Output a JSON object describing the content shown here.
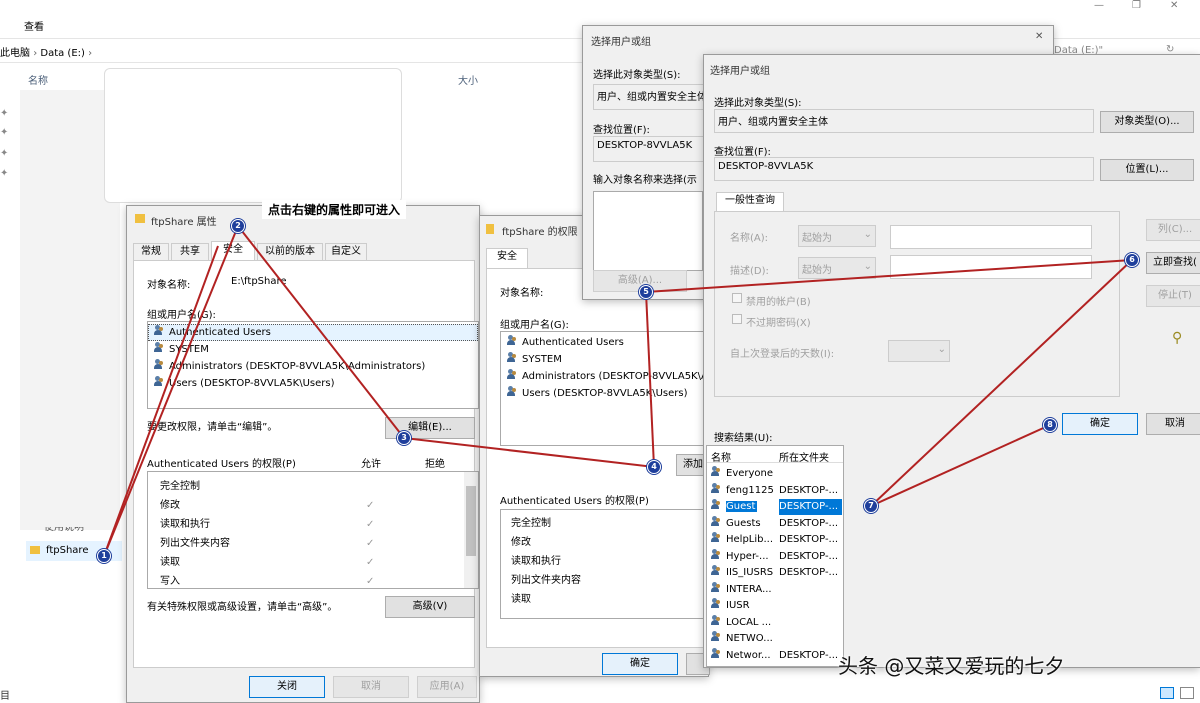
{
  "explorer": {
    "menu_view": "查看",
    "breadcrumb": [
      "此电脑",
      "Data (E:)"
    ],
    "col_name": "名称",
    "col_size": "大小",
    "folder": "ftpShare",
    "partial_item": "使用说明",
    "status_left": "目"
  },
  "annotation": "点击右键的属性即可进入",
  "props": {
    "title": "ftpShare 属性",
    "tabs": [
      "常规",
      "共享",
      "安全",
      "以前的版本",
      "自定义"
    ],
    "object_label": "对象名称:",
    "object_value": "E:\\ftpShare",
    "group_label": "组或用户名(G):",
    "users": [
      "Authenticated Users",
      "SYSTEM",
      "Administrators (DESKTOP-8VVLA5K\\Administrators)",
      "Users (DESKTOP-8VVLA5K\\Users)"
    ],
    "change_hint": "要更改权限，请单击“编辑”。",
    "edit": "编辑(E)...",
    "perm_label": "Authenticated Users 的权限(P)",
    "allow": "允许",
    "deny": "拒绝",
    "perms": [
      "完全控制",
      "修改",
      "读取和执行",
      "列出文件夹内容",
      "读取",
      "写入"
    ],
    "adv_hint": "有关特殊权限或高级设置，请单击“高级”。",
    "advanced": "高级(V)",
    "close": "关闭",
    "cancel": "取消",
    "apply": "应用(A)"
  },
  "perm_dlg": {
    "title": "ftpShare 的权限",
    "tab": "安全",
    "object_label": "对象名称:",
    "group_label": "组或用户名(G):",
    "users": [
      "Authenticated Users",
      "SYSTEM",
      "Administrators (DESKTOP-8VVLA5K\\Ad",
      "Users (DESKTOP-8VVLA5K\\Users)"
    ],
    "add": "添加",
    "perm_label": "Authenticated Users 的权限(P)",
    "perms": [
      "完全控制",
      "修改",
      "读取和执行",
      "列出文件夹内容",
      "读取"
    ],
    "ok": "确定"
  },
  "sel1": {
    "title": "选择用户或组",
    "type_label": "选择此对象类型(S):",
    "type_value": "用户、组或内置安全主体",
    "loc_label": "查找位置(F):",
    "loc_value": "DESKTOP-8VVLA5K",
    "enter_label": "输入对象名称来选择(示",
    "advanced": "高级(A)...",
    "peek": "Data (E:)\""
  },
  "sel2": {
    "title": "选择用户或组",
    "type_label": "选择此对象类型(S):",
    "type_value": "用户、组或内置安全主体",
    "type_btn": "对象类型(O)...",
    "loc_label": "查找位置(F):",
    "loc_value": "DESKTOP-8VVLA5K",
    "loc_btn": "位置(L)...",
    "tab": "一般性查询",
    "name_label": "名称(A):",
    "desc_label": "描述(D):",
    "starts": "起始为",
    "cols_btn": "列(C)...",
    "find_btn": "立即查找(",
    "stop_btn": "停止(T)",
    "disabled_acct": "禁用的帐户(B)",
    "no_expire": "不过期密码(X)",
    "days_label": "自上次登录后的天数(I):",
    "ok": "确定",
    "cancel": "取消",
    "results_label": "搜索结果(U):",
    "col_name": "名称",
    "col_folder": "所在文件夹",
    "results": [
      {
        "name": "Everyone",
        "folder": ""
      },
      {
        "name": "feng1125",
        "folder": "DESKTOP-..."
      },
      {
        "name": "Guest",
        "folder": "DESKTOP-..."
      },
      {
        "name": "Guests",
        "folder": "DESKTOP-..."
      },
      {
        "name": "HelpLib...",
        "folder": "DESKTOP-..."
      },
      {
        "name": "Hyper-...",
        "folder": "DESKTOP-..."
      },
      {
        "name": "IIS_IUSRS",
        "folder": "DESKTOP-..."
      },
      {
        "name": "INTERA...",
        "folder": ""
      },
      {
        "name": "IUSR",
        "folder": ""
      },
      {
        "name": "LOCAL ...",
        "folder": ""
      },
      {
        "name": "NETWO...",
        "folder": ""
      },
      {
        "name": "Networ...",
        "folder": "DESKTOP-..."
      }
    ]
  },
  "steps": [
    "1",
    "2",
    "3",
    "4",
    "5",
    "6",
    "7",
    "8"
  ],
  "watermark": "头条 @又菜又爱玩的七夕",
  "colors": {
    "annotation_line": "#b22222",
    "step_badge": "#1f3f9c",
    "selection": "#0078d7"
  }
}
